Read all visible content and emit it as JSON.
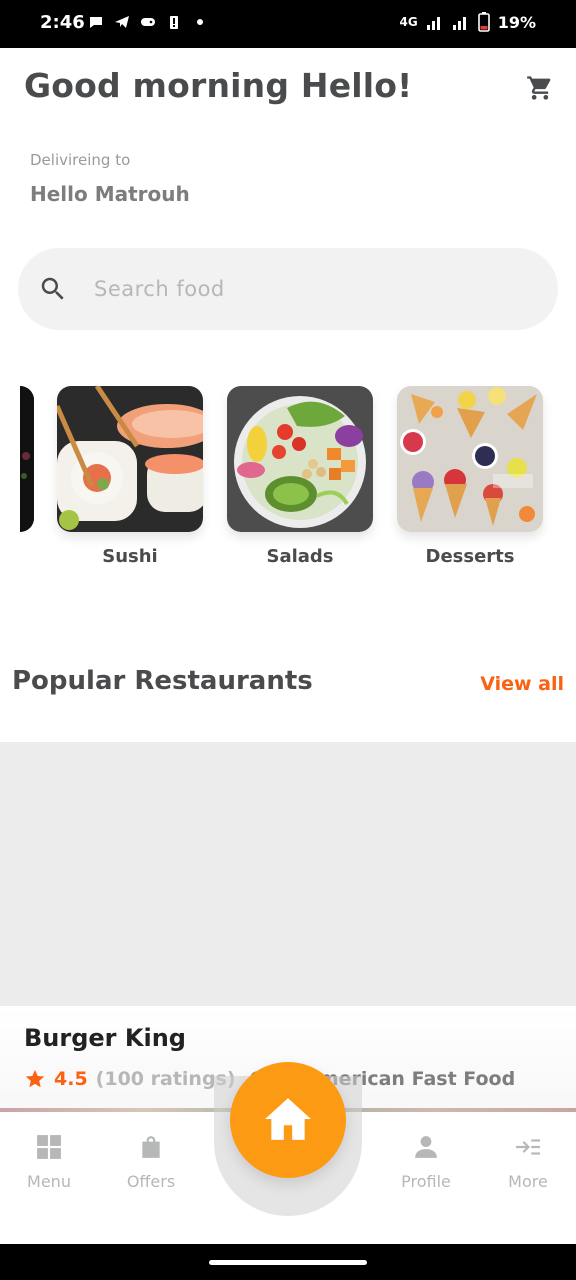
{
  "status_bar": {
    "time": "2:46",
    "network": "4G",
    "battery": "19%"
  },
  "header": {
    "greeting": "Good morning Hello!",
    "delivering_label": "Delivireing to",
    "delivering_value": "Hello Matrouh"
  },
  "search": {
    "placeholder": "Search food",
    "value": ""
  },
  "categories": [
    {
      "label": "Sushi"
    },
    {
      "label": "Salads"
    },
    {
      "label": "Desserts"
    }
  ],
  "popular": {
    "title": "Popular Restaurants",
    "view_all": "View all",
    "restaurant": {
      "name": "Burger King",
      "rating": "4.5",
      "ratings_count": "(100 ratings)",
      "type": "Café  American Fast Food"
    }
  },
  "bottom_nav": {
    "items": [
      {
        "label": "Menu"
      },
      {
        "label": "Offers"
      },
      {
        "label": "Profile"
      },
      {
        "label": "More"
      }
    ]
  },
  "colors": {
    "accent": "#fc6011",
    "home_button": "#fc9a13",
    "primary_text": "#4a4b4d",
    "secondary_text": "#7c7d7e",
    "placeholder_text": "#b6b7b7"
  }
}
